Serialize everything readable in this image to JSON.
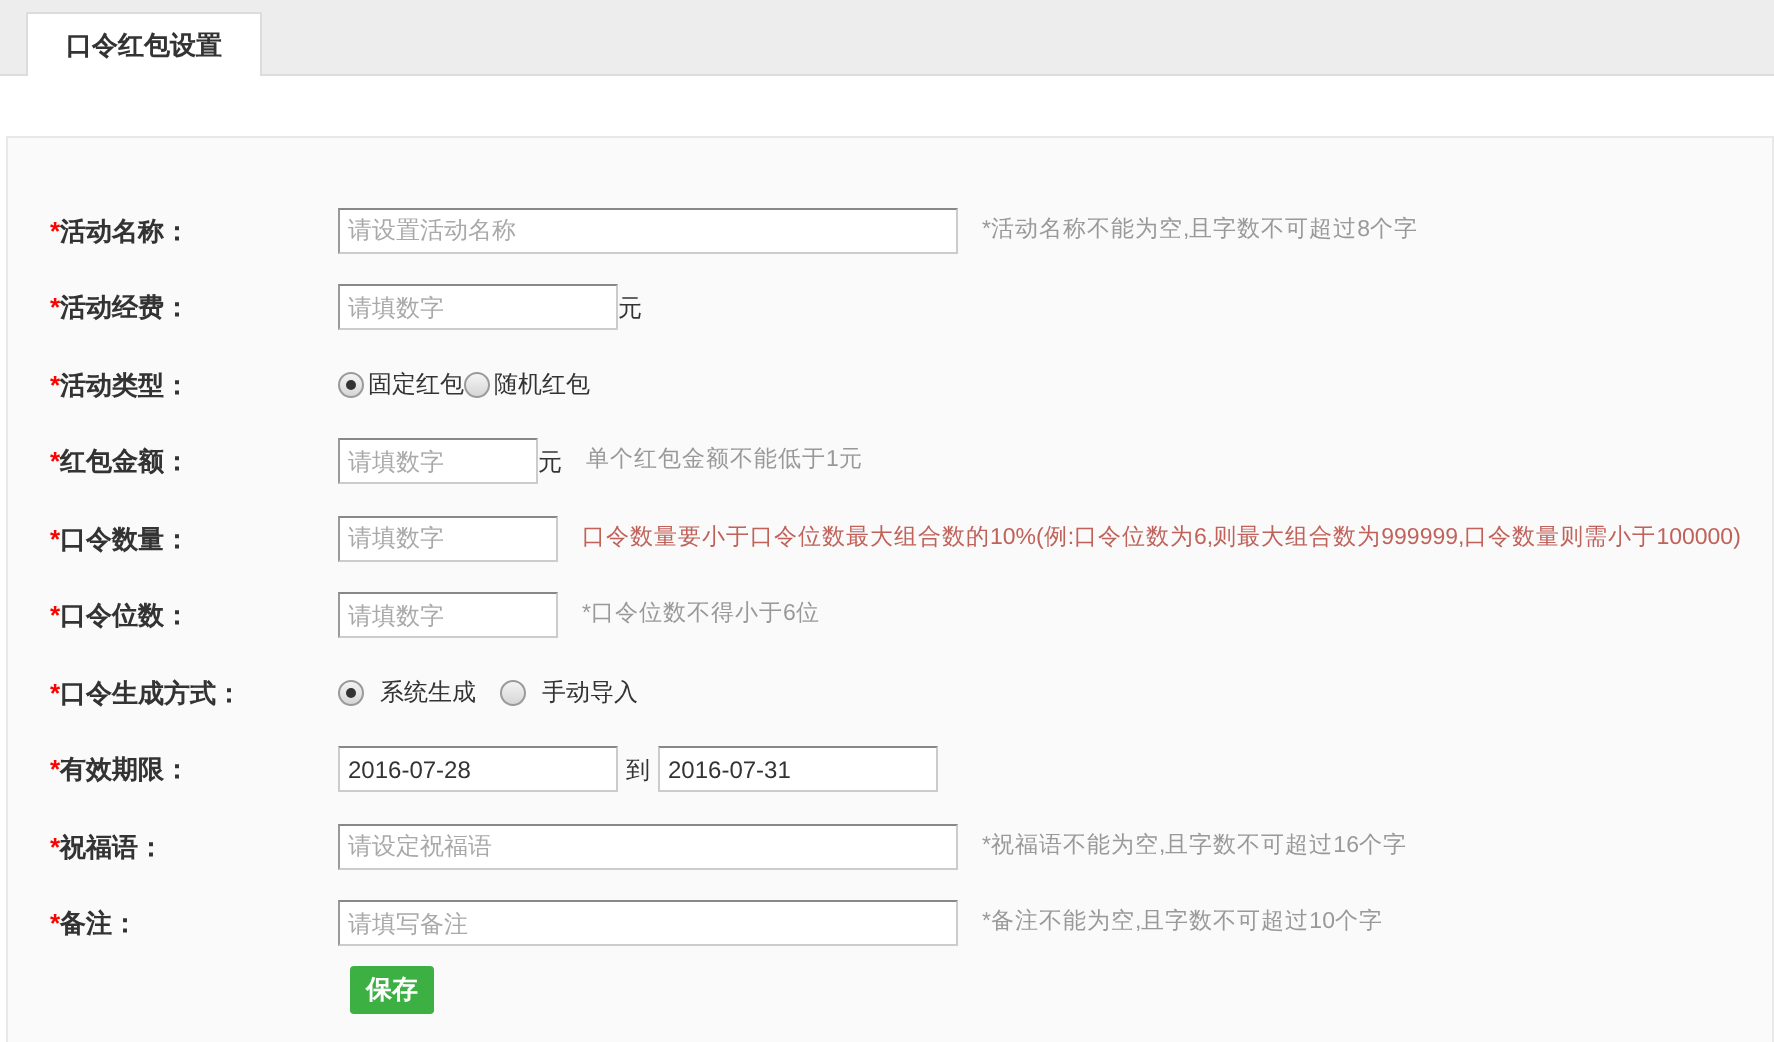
{
  "tabs": [
    {
      "label": "口令红包设置",
      "selected": true
    }
  ],
  "form": {
    "rows": [
      {
        "required_mark": "*",
        "label": "活动名称：",
        "kind": "text",
        "placeholder": "请设置活动名称",
        "hint": {
          "text": "*活动名称不能为空,且字数不可超过8个字",
          "kind": "note"
        }
      },
      {
        "required_mark": "*",
        "label": "活动经费：",
        "kind": "text",
        "placeholder": "请填数字",
        "unit": "元"
      },
      {
        "required_mark": "*",
        "label": "活动类型：",
        "kind": "radio",
        "options": [
          {
            "label": "固定红包",
            "selected": true
          },
          {
            "label": "随机红包",
            "selected": false
          }
        ]
      },
      {
        "required_mark": "*",
        "label": "红包金额：",
        "kind": "text",
        "placeholder": "请填数字",
        "unit": "元",
        "hint": {
          "text": "单个红包金额不能低于1元",
          "kind": "note"
        }
      },
      {
        "required_mark": "*",
        "label": "口令数量：",
        "kind": "text",
        "placeholder": "请填数字",
        "hint": {
          "text": "口令数量要小于口令位数最大组合数的10%(例:口令位数为6,则最大组合数为999999,口令数量则需小于100000)",
          "kind": "warning"
        }
      },
      {
        "required_mark": "*",
        "label": "口令位数：",
        "kind": "text",
        "placeholder": "请填数字",
        "hint": {
          "text": "*口令位数不得小于6位",
          "kind": "note"
        }
      },
      {
        "required_mark": "*",
        "label": "口令生成方式：",
        "kind": "radio",
        "options": [
          {
            "label": "系统生成",
            "selected": true
          },
          {
            "label": "手动导入",
            "selected": false
          }
        ]
      },
      {
        "required_mark": "*",
        "label": "有效期限：",
        "kind": "daterange",
        "from": "2016-07-28",
        "separator": "到",
        "to": "2016-07-31"
      },
      {
        "required_mark": "*",
        "label": "祝福语：",
        "kind": "text",
        "placeholder": "请设定祝福语",
        "hint": {
          "text": "*祝福语不能为空,且字数不可超过16个字",
          "kind": "note"
        }
      },
      {
        "required_mark": "*",
        "label": "备注：",
        "kind": "text",
        "placeholder": "请填写备注",
        "hint": {
          "text": "*备注不能为空,且字数不可超过10个字",
          "kind": "note"
        }
      }
    ],
    "save_button": "保存"
  }
}
